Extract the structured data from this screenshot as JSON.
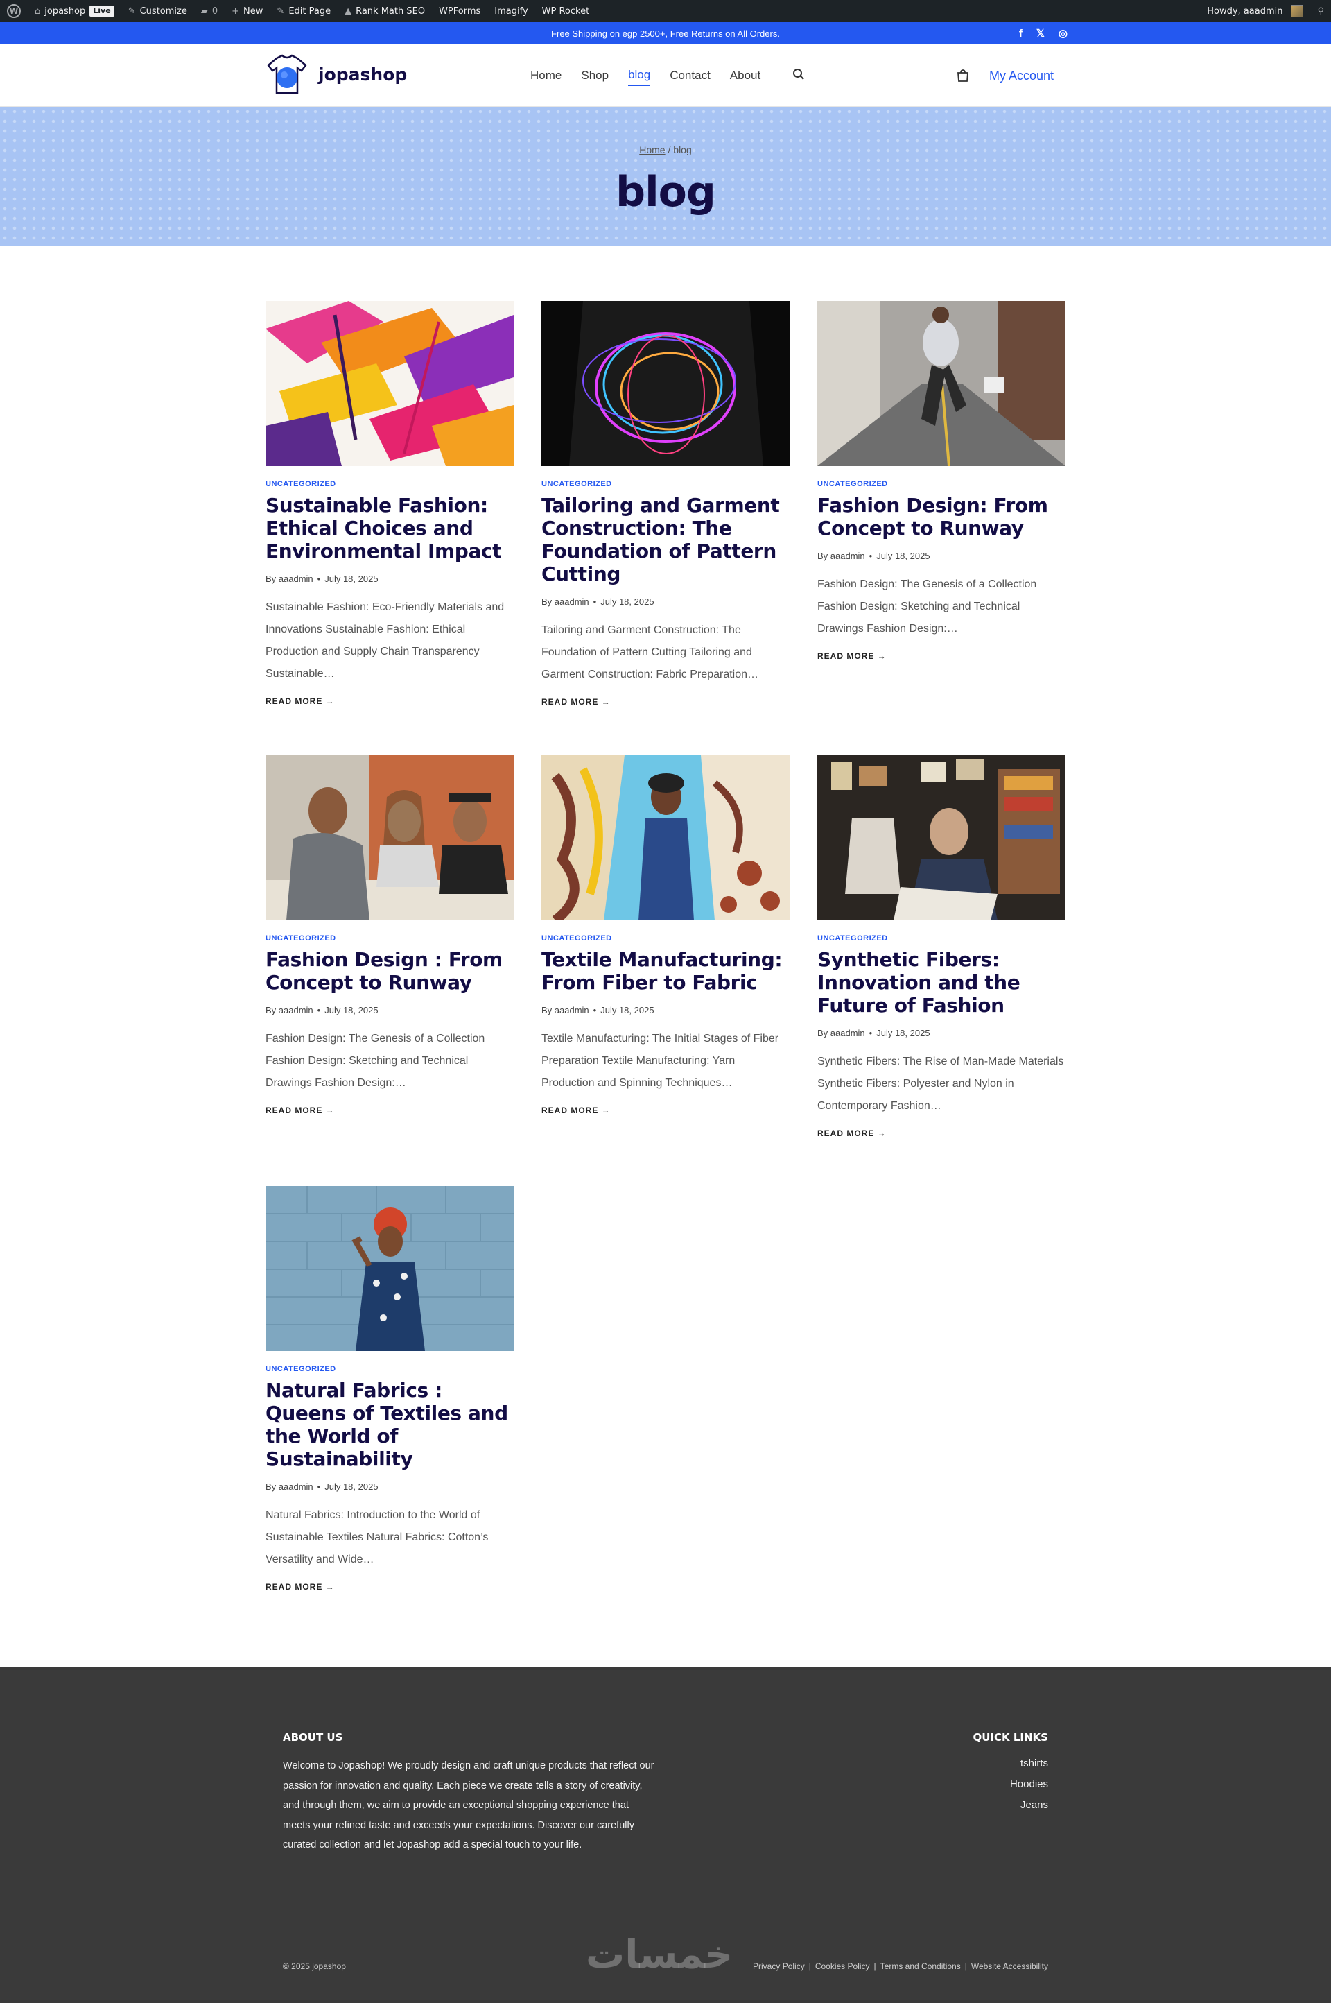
{
  "admin_bar": {
    "site": "jopashop",
    "live": "Live",
    "customize": "Customize",
    "comments": "0",
    "new": "New",
    "edit_page": "Edit Page",
    "rank_math": "Rank Math SEO",
    "wpforms": "WPForms",
    "imagify": "Imagify",
    "wp_rocket": "WP Rocket",
    "howdy": "Howdy, aaadmin"
  },
  "promo": {
    "text": "Free Shipping on egp 2500+, Free Returns on All Orders."
  },
  "header": {
    "logo_text": "jopashop",
    "nav": [
      "Home",
      "Shop",
      "blog",
      "Contact",
      "About"
    ],
    "account": "My Account"
  },
  "hero": {
    "crumb_home": "Home",
    "crumb_sep": " / ",
    "crumb_current": "blog",
    "title": "blog"
  },
  "posts": [
    {
      "category": "UNCATEGORIZED",
      "title": "Sustainable Fashion: Ethical Choices and Environmental Impact",
      "author": "By aaadmin",
      "date": "July 18, 2025",
      "excerpt": "Sustainable Fashion: Eco-Friendly Materials and Innovations Sustainable Fashion: Ethical Production and Supply Chain Transparency Sustainable…",
      "more": "READ MORE →"
    },
    {
      "category": "UNCATEGORIZED",
      "title": "Tailoring and Garment Construction: The Foundation of Pattern Cutting",
      "author": "By aaadmin",
      "date": "July 18, 2025",
      "excerpt": "Tailoring and Garment Construction: The Foundation of Pattern Cutting Tailoring and Garment Construction: Fabric Preparation…",
      "more": "READ MORE →"
    },
    {
      "category": "UNCATEGORIZED",
      "title": "Fashion Design: From Concept to Runway",
      "author": "By aaadmin",
      "date": "July 18, 2025",
      "excerpt": "Fashion Design: The Genesis of a Collection Fashion Design: Sketching and Technical Drawings Fashion Design:…",
      "more": "READ MORE →"
    },
    {
      "category": "UNCATEGORIZED",
      "title": "Fashion Design : From Concept to Runway",
      "author": "By aaadmin",
      "date": "July 18, 2025",
      "excerpt": "Fashion Design: The Genesis of a Collection Fashion Design: Sketching and Technical Drawings Fashion Design:…",
      "more": "READ MORE →"
    },
    {
      "category": "UNCATEGORIZED",
      "title": "Textile Manufacturing: From Fiber to Fabric",
      "author": "By aaadmin",
      "date": "July 18, 2025",
      "excerpt": "Textile Manufacturing: The Initial Stages of Fiber Preparation Textile Manufacturing: Yarn Production and Spinning Techniques…",
      "more": "READ MORE →"
    },
    {
      "category": "UNCATEGORIZED",
      "title": "Synthetic Fibers: Innovation and the Future of Fashion",
      "author": "By aaadmin",
      "date": "July 18, 2025",
      "excerpt": "Synthetic Fibers: The Rise of Man-Made Materials Synthetic Fibers: Polyester and Nylon in Contemporary Fashion…",
      "more": "READ MORE →"
    },
    {
      "category": "UNCATEGORIZED",
      "title": "Natural Fabrics : Queens of Textiles and the World of Sustainability",
      "author": "By aaadmin",
      "date": "July 18, 2025",
      "excerpt": "Natural Fabrics: Introduction to the World of Sustainable Textiles Natural Fabrics: Cotton’s Versatility and Wide…",
      "more": "READ MORE →"
    }
  ],
  "footer": {
    "about_heading": "ABOUT US",
    "about_text": "Welcome to Jopashop! We proudly design and craft unique products that reflect our passion for innovation and quality. Each piece we create tells a story of creativity, and through them, we aim to provide an exceptional shopping experience that meets your refined taste and exceeds your expectations. Discover our carefully curated collection and let Jopashop add a special touch to your life.",
    "links_heading": "QUICK LINKS",
    "links": [
      "tshirts",
      "Hoodies",
      "Jeans"
    ],
    "copyright": "© 2025 jopashop",
    "legal": [
      "Privacy Policy",
      "Cookies Policy",
      "Terms and Conditions",
      "Website Accessibility"
    ],
    "watermark": "خمسات"
  },
  "colors": {
    "brand_blue": "#2458f0",
    "navy": "#130d45",
    "hero_bg": "#a8c4f4",
    "footer_bg": "#3a3a3a"
  }
}
